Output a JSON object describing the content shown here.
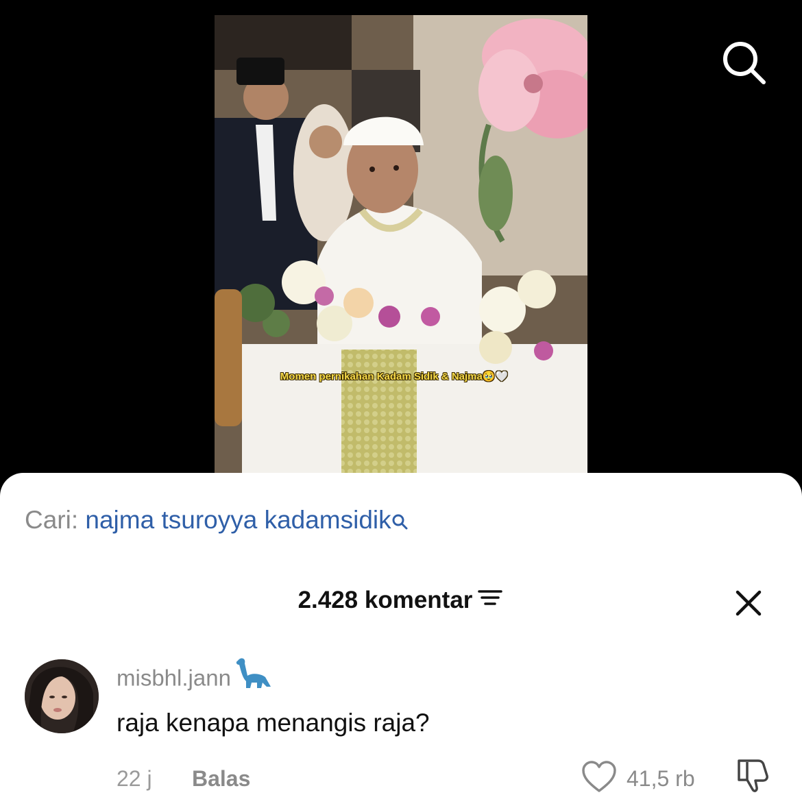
{
  "video": {
    "caption": "Momen pernikahan Kadam Sidik & Najma🥹🤍"
  },
  "search_suggestion": {
    "prefix": "Cari:",
    "query": "najma tsuroyya kadamsidik"
  },
  "comments_header": {
    "title": "2.428 komentar"
  },
  "comment": {
    "username": "misbhl.jann",
    "text": "raja kenapa menangis raja?",
    "time": "22 j",
    "reply_label": "Balas",
    "like_count": "41,5 rb"
  },
  "icons": {
    "search": "search-icon",
    "sort": "sort-icon",
    "close": "close-icon",
    "like": "heart-icon",
    "dislike": "thumbs-down-icon",
    "user_emoji": "dinosaur-emoji"
  },
  "colors": {
    "link_blue": "#2f5fa8",
    "muted_gray": "#8a8a8a",
    "caption_yellow": "#f5d94a"
  }
}
